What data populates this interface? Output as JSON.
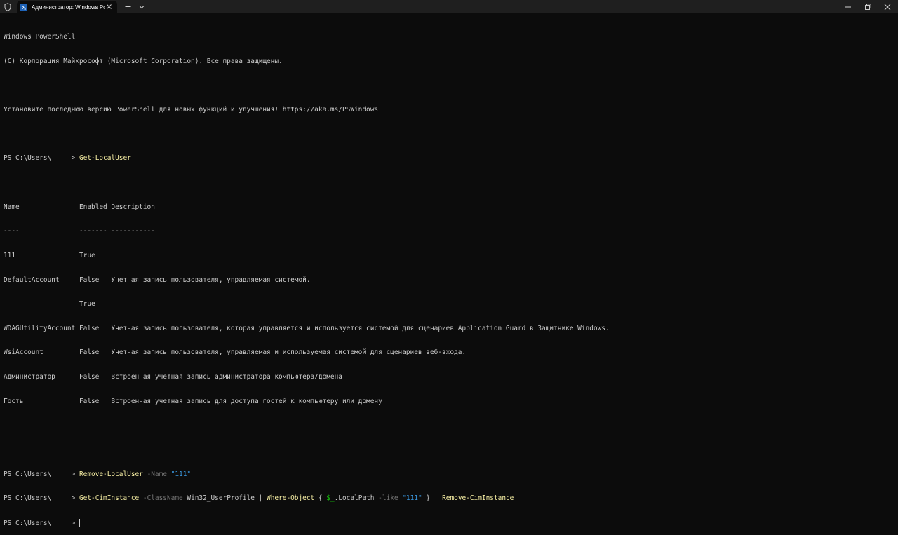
{
  "window": {
    "tab_title": "Администратор: Windows PowerShell",
    "icons": {
      "admin": "shield-icon",
      "tab": "powershell-icon",
      "close_tab": "close-icon",
      "new_tab": "plus-icon",
      "dropdown": "chevron-down-icon",
      "minimize": "minimize-icon",
      "maximize": "maximize-icon",
      "close": "close-icon"
    }
  },
  "colors": {
    "background": "#0c0c0c",
    "titlebar": "#1f1f1f",
    "text": "#cccccc",
    "command": "#f9f1a5",
    "parameter": "#767676",
    "string": "#3a96dd",
    "variable": "#16c60c"
  },
  "terminal": {
    "header_line1": "Windows PowerShell",
    "header_line2": "(C) Корпорация Майкрософт (Microsoft Corporation). Все права защищены.",
    "header_line3": "Установите последнюю версию PowerShell для новых функций и улучшения! https://aka.ms/PSWindows",
    "prompt": "PS C:\\Users\\     > ",
    "cmd1": "Get-LocalUser",
    "table_header": "Name               Enabled Description",
    "table_sep": "----               ------- -----------",
    "rows": [
      "111                True",
      "DefaultAccount     False   Учетная запись пользователя, управляемая системой.",
      "                   True",
      "WDAGUtilityAccount False   Учетная запись пользователя, которая управляется и используется системой для сценариев Application Guard в Защитнике Windows.",
      "WsiAccount         False   Учетная запись пользователя, управляемая и используемая системой для сценариев веб-входа.",
      "Администратор      False   Встроенная учетная запись администратора компьютера/домена",
      "Гость              False   Встроенная учетная запись для доступа гостей к компьютеру или домену"
    ],
    "cmd2": {
      "command": "Remove-LocalUser",
      "param": " -Name ",
      "value": "\"111\""
    },
    "cmd3": {
      "command": "Get-CimInstance",
      "param1": " -ClassName ",
      "arg1": "Win32_UserProfile | ",
      "command2": "Where-Object",
      "arg2": " { ",
      "var": "$_",
      "prop": ".LocalPath",
      "param2": " -like ",
      "value": "\"111\"",
      "arg3": " } | ",
      "command3": "Remove-CimInstance"
    }
  }
}
